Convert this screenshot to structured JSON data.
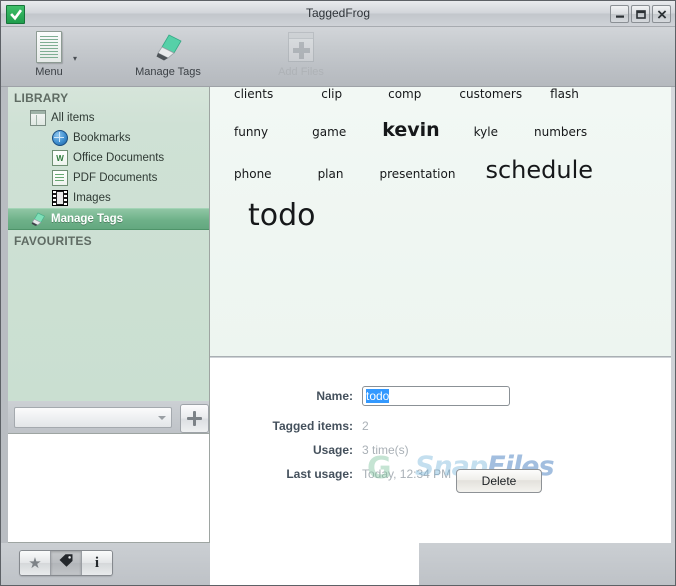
{
  "window": {
    "title": "TaggedFrog",
    "app_icon": "checkmark-icon",
    "minimize_label": "Minimize",
    "maximize_label": "Maximize",
    "close_label": "Close"
  },
  "ribbon": {
    "items": [
      {
        "label": "Menu",
        "icon": "document-list-icon",
        "has_dropdown": true,
        "enabled": true
      },
      {
        "label": "Manage Tags",
        "icon": "pencil-icon",
        "has_dropdown": false,
        "enabled": true
      },
      {
        "label": "Add Files",
        "icon": "add-file-icon",
        "has_dropdown": false,
        "enabled": false
      }
    ]
  },
  "sidebar": {
    "sections": [
      {
        "header": "LIBRARY",
        "items": [
          {
            "label": "All items",
            "icon": "all-items-icon",
            "level": 1,
            "selected": false
          },
          {
            "label": "Bookmarks",
            "icon": "globe-icon",
            "level": 2,
            "selected": false
          },
          {
            "label": "Office Documents",
            "icon": "word-doc-icon",
            "level": 2,
            "selected": false
          },
          {
            "label": "PDF Documents",
            "icon": "pdf-doc-icon",
            "level": 2,
            "selected": false
          },
          {
            "label": "Images",
            "icon": "film-strip-icon",
            "level": 2,
            "selected": false
          },
          {
            "label": "Manage Tags",
            "icon": "tag-pencil-icon",
            "level": 1,
            "selected": true
          }
        ]
      },
      {
        "header": "FAVOURITES",
        "items": []
      }
    ],
    "filter_combo": {
      "value": "",
      "placeholder": "",
      "dropdown_icon": "chevron-down-icon"
    },
    "add_button": {
      "icon": "plus-icon",
      "label": ""
    },
    "view_buttons": [
      {
        "icon": "star-icon",
        "name": "favourites",
        "active": false,
        "glyph": "★"
      },
      {
        "icon": "tag-icon",
        "name": "tags",
        "active": true,
        "glyph": ""
      },
      {
        "icon": "info-icon",
        "name": "info",
        "active": false,
        "glyph": "i"
      }
    ]
  },
  "tag_cloud": {
    "rows": [
      [
        {
          "text": "clients",
          "size": 12,
          "weight": 400,
          "gap": 0
        },
        {
          "text": "clip",
          "size": 12,
          "weight": 400,
          "gap": 48
        },
        {
          "text": "comp",
          "size": 12,
          "weight": 400,
          "gap": 46
        },
        {
          "text": "customers",
          "size": 12,
          "weight": 400,
          "gap": 38
        },
        {
          "text": "flash",
          "size": 12,
          "weight": 400,
          "gap": 28
        }
      ],
      [
        {
          "text": "funny",
          "size": 12,
          "weight": 400,
          "gap": 0
        },
        {
          "text": "game",
          "size": 12,
          "weight": 400,
          "gap": 44
        },
        {
          "text": "kevin",
          "size": 19,
          "weight": 700,
          "gap": 36
        },
        {
          "text": "kyle",
          "size": 12,
          "weight": 400,
          "gap": 34
        },
        {
          "text": "numbers",
          "size": 12,
          "weight": 400,
          "gap": 36
        }
      ],
      [
        {
          "text": "phone",
          "size": 12,
          "weight": 400,
          "gap": 0
        },
        {
          "text": "plan",
          "size": 12,
          "weight": 400,
          "gap": 46
        },
        {
          "text": "presentation",
          "size": 12,
          "weight": 400,
          "gap": 36
        },
        {
          "text": "schedule",
          "size": 24,
          "weight": 400,
          "gap": 30
        }
      ],
      [
        {
          "text": "todo",
          "size": 30,
          "weight": 400,
          "gap": 0
        }
      ]
    ]
  },
  "details": {
    "fields": [
      {
        "label": "Name:",
        "type": "input",
        "value": "todo"
      },
      {
        "label": "Tagged items:",
        "type": "text",
        "value": "2"
      },
      {
        "label": "Usage:",
        "type": "text",
        "value": "3 time(s)"
      },
      {
        "label": "Last usage:",
        "type": "text",
        "value": "Today, 12:34 PM"
      }
    ],
    "delete_label": "Delete"
  },
  "watermark": {
    "logo": "G",
    "part1": "Snap",
    "part2": "Files"
  },
  "colors": {
    "accent_green": "#6eb189",
    "selection_blue": "#3399ff",
    "cloud_bg": "#eff6f2",
    "label_color": "#44505c",
    "value_color": "#a9b0b6"
  }
}
